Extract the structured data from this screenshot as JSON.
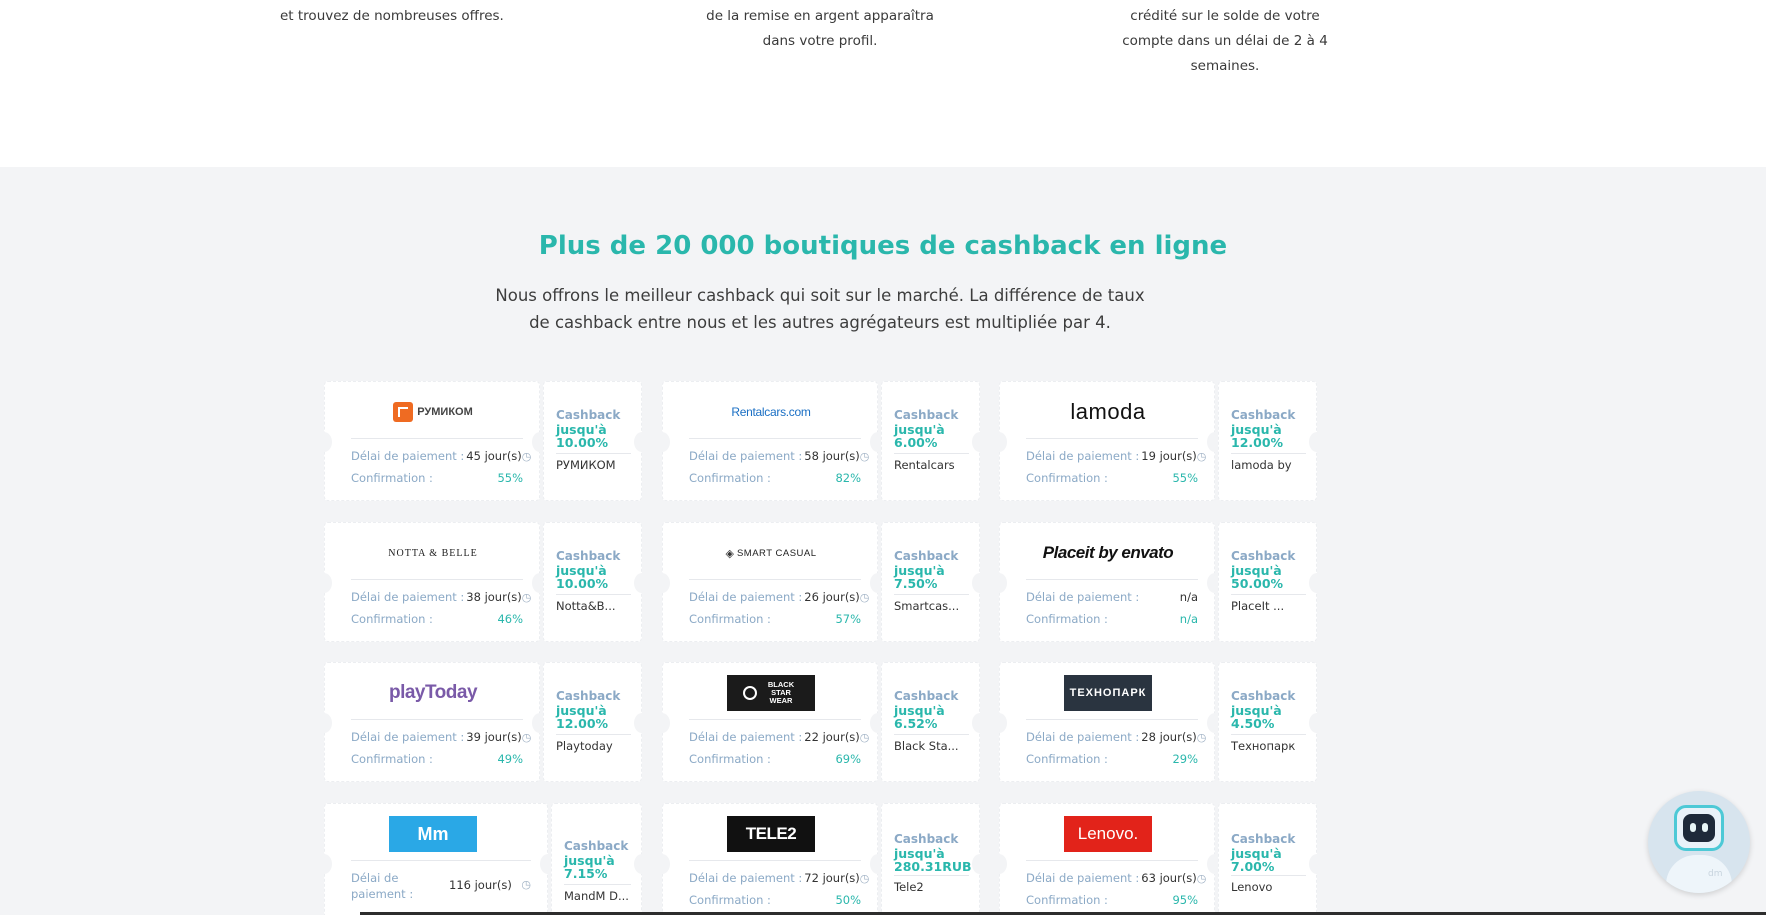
{
  "steps": [
    {
      "text": "et trouvez de nombreuses offres."
    },
    {
      "text": "de la remise en argent apparaîtra dans votre profil."
    },
    {
      "text": "crédité sur le solde de votre compte dans un délai de 2 à 4 semaines."
    }
  ],
  "shops": {
    "title": "Plus de 20 000 boutiques de cashback en ligne",
    "subtitle": "Nous offrons le meilleur cashback qui soit sur le marché. La différence de taux de cashback entre nous et les autres agrégateurs est multipliée par 4.",
    "delay_label": "Délai de paiement :",
    "confirm_label": "Confirmation :",
    "cashback_label": "Cashback",
    "cards": [
      {
        "logo": "РУМИКОМ",
        "days": "45 jour(s)",
        "confirmation": "55%",
        "cashback": "jusqu'à 10.00%",
        "name": "РУМИКОМ"
      },
      {
        "logo": "Rentalcars.com",
        "days": "58 jour(s)",
        "confirmation": "82%",
        "cashback": "jusqu'à 6.00%",
        "name": "Rentalcars"
      },
      {
        "logo": "lamoda",
        "days": "19 jour(s)",
        "confirmation": "55%",
        "cashback": "jusqu'à 12.00%",
        "name": "lamoda by"
      },
      {
        "logo": "NOTTA & BELLE",
        "days": "38 jour(s)",
        "confirmation": "46%",
        "cashback": "jusqu'à 10.00%",
        "name": "Notta&B..."
      },
      {
        "logo": "SMART CASUAL",
        "days": "26 jour(s)",
        "confirmation": "57%",
        "cashback": "jusqu'à 7.50%",
        "name": "Smartcas..."
      },
      {
        "logo": "Placeit by envato",
        "days": "n/a",
        "confirmation": "n/a",
        "cashback": "jusqu'à 50.00%",
        "name": "PlaceIt ..."
      },
      {
        "logo": "playToday",
        "days": "39 jour(s)",
        "confirmation": "49%",
        "cashback": "jusqu'à 12.00%",
        "name": "Playtoday"
      },
      {
        "logo": "BLACK STAR WEAR",
        "days": "22 jour(s)",
        "confirmation": "69%",
        "cashback": "jusqu'à 6.52%",
        "name": "Black Sta..."
      },
      {
        "logo": "ТЕХНОПАРК",
        "days": "28 jour(s)",
        "confirmation": "29%",
        "cashback": "jusqu'à 4.50%",
        "name": "Технопарк"
      },
      {
        "logo": "Mm",
        "days": "116 jour(s)",
        "confirmation": "",
        "cashback": "jusqu'à 7.15%",
        "name": "MandM D..."
      },
      {
        "logo": "TELE2",
        "days": "72 jour(s)",
        "confirmation": "50%",
        "cashback": "jusqu'à 280.31RUB",
        "name": "Tele2"
      },
      {
        "logo": "Lenovo.",
        "days": "63 jour(s)",
        "confirmation": "95%",
        "cashback": "jusqu'à 7.00%",
        "name": "Lenovo"
      }
    ]
  },
  "chatbot": {
    "mark": "dm"
  },
  "colors": {
    "accent": "#2ab7ac",
    "label": "#8ba9c6",
    "section_bg": "#f3f4f6"
  }
}
